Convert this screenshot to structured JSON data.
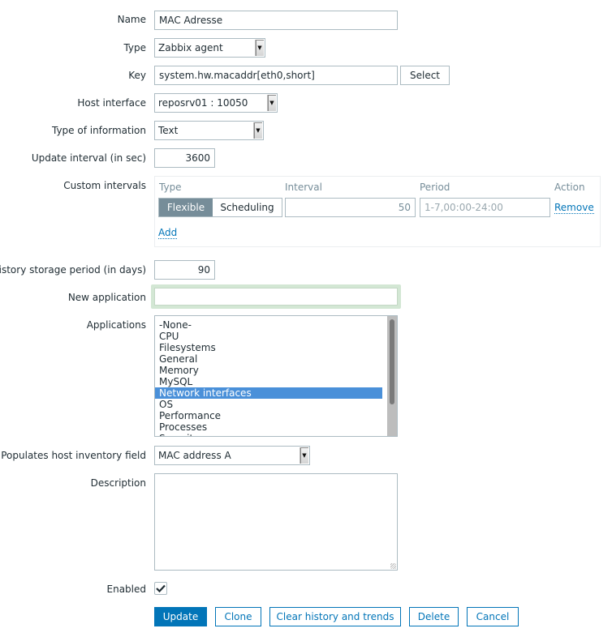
{
  "form": {
    "name": {
      "label": "Name",
      "value": "MAC Adresse"
    },
    "type": {
      "label": "Type",
      "value": "Zabbix agent"
    },
    "key": {
      "label": "Key",
      "value": "system.hw.macaddr[eth0,short]",
      "select_button": "Select"
    },
    "host_interface": {
      "label": "Host interface",
      "value": "reposrv01 : 10050"
    },
    "type_of_information": {
      "label": "Type of information",
      "value": "Text"
    },
    "update_interval": {
      "label": "Update interval (in sec)",
      "value": "3600"
    },
    "custom_intervals": {
      "label": "Custom intervals",
      "headers": {
        "type": "Type",
        "interval": "Interval",
        "period": "Period",
        "action": "Action"
      },
      "rows": [
        {
          "type_options": [
            "Flexible",
            "Scheduling"
          ],
          "selected_type": "Flexible",
          "interval": "50",
          "period_placeholder": "1-7,00:00-24:00",
          "action": "Remove"
        }
      ],
      "add_label": "Add"
    },
    "history_storage": {
      "label": "History storage period (in days)",
      "value": "90"
    },
    "new_application": {
      "label": "New application",
      "value": ""
    },
    "applications": {
      "label": "Applications",
      "items": [
        "-None-",
        "CPU",
        "Filesystems",
        "General",
        "Memory",
        "MySQL",
        "Network interfaces",
        "OS",
        "Performance",
        "Processes",
        "Security"
      ],
      "selected": "Network interfaces"
    },
    "inventory_field": {
      "label": "Populates host inventory field",
      "value": "MAC address A"
    },
    "description": {
      "label": "Description",
      "value": ""
    },
    "enabled": {
      "label": "Enabled",
      "checked": true
    }
  },
  "buttons": {
    "update": "Update",
    "clone": "Clone",
    "clear_history": "Clear history and trends",
    "delete": "Delete",
    "cancel": "Cancel"
  },
  "colors": {
    "accent": "#0275b8",
    "selected_row": "#4a90d9",
    "toggle_active": "#768d99"
  }
}
